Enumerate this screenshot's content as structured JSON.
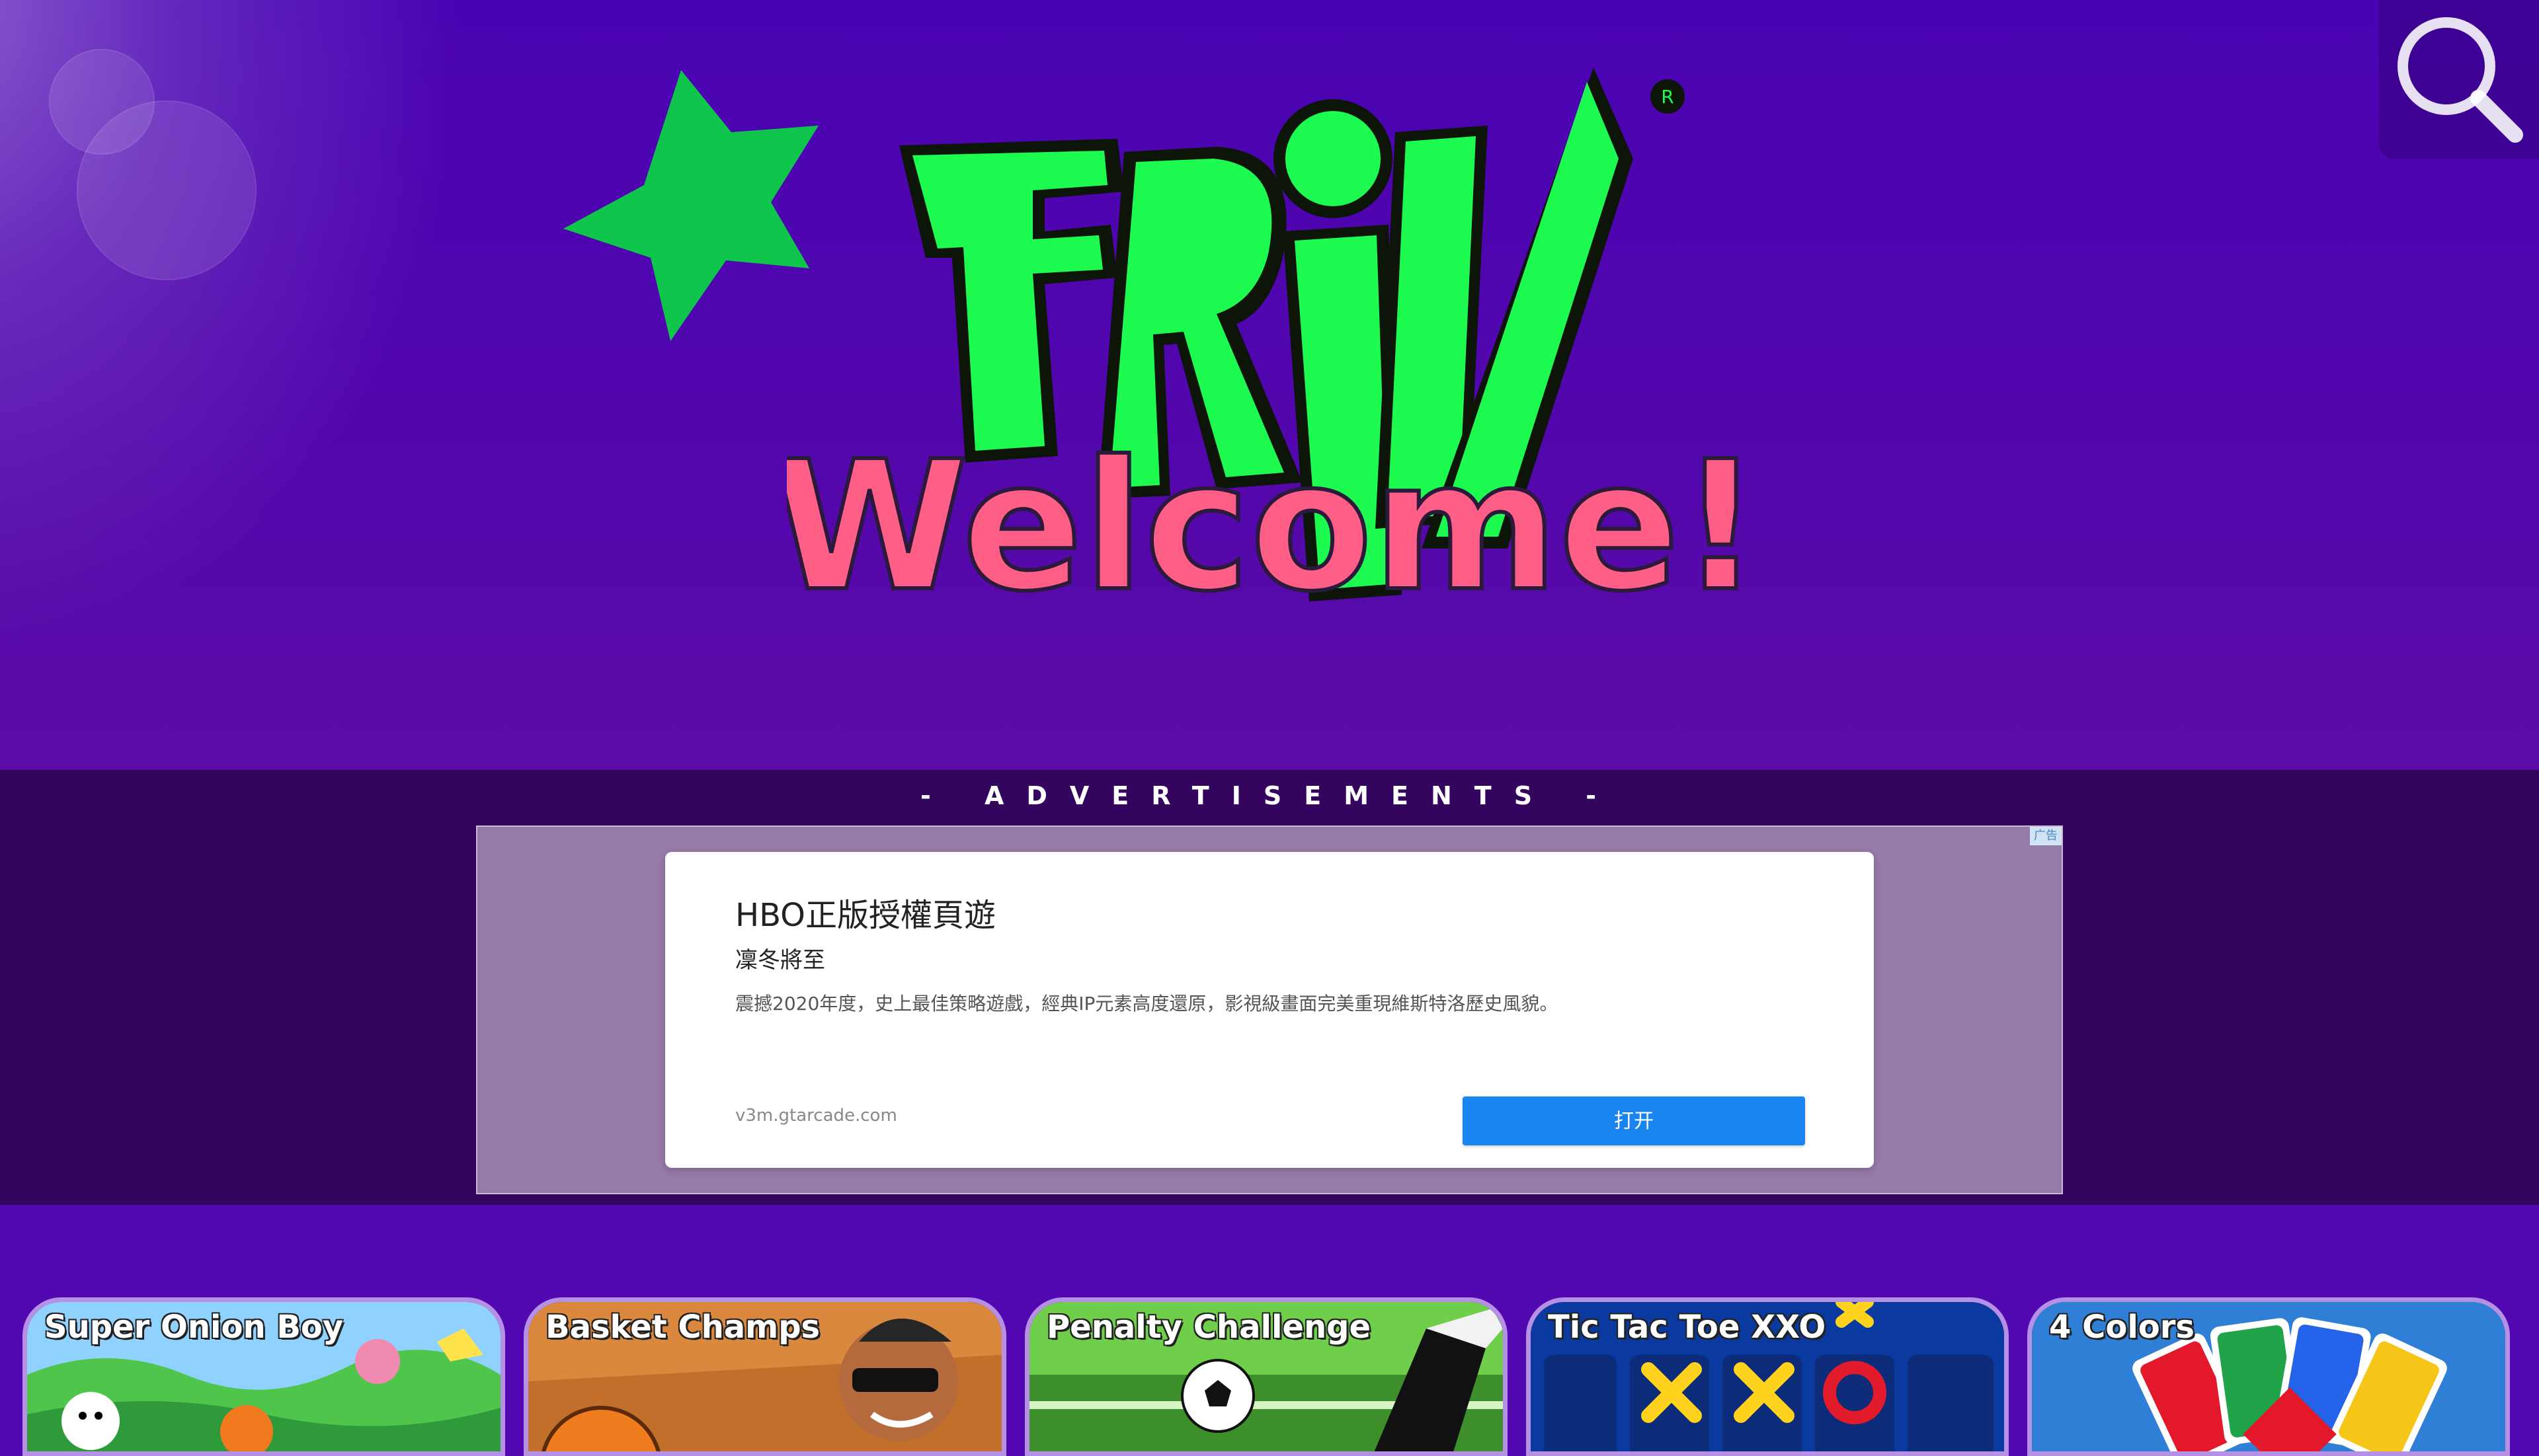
{
  "brand": {
    "logo_text": "FRIV",
    "registered_mark": "R",
    "welcome": "Welcome!",
    "colors": {
      "logo_green": "#1dfb50",
      "star_green": "#0fc44c",
      "welcome_pink": "#ff5e86",
      "background": "#5208b0"
    }
  },
  "header": {
    "search_icon": "search-icon"
  },
  "ads": {
    "label": "- ADVERTISEMENTS -",
    "corner_badge": "广告",
    "title": "HBO正版授權頁遊",
    "subtitle": "凜冬將至",
    "description": "震撼2020年度，史上最佳策略遊戲，經典IP元素高度還原，影視級畫面完美重現維斯特洛歷史風貌。",
    "domain": "v3m.gtarcade.com",
    "cta_label": "打开",
    "cta_color": "#1a84f0"
  },
  "games": [
    {
      "title": "Super Onion Boy"
    },
    {
      "title": "Basket Champs"
    },
    {
      "title": "Penalty Challenge"
    },
    {
      "title": "Tic Tac Toe XXO"
    },
    {
      "title": "4 Colors"
    }
  ]
}
